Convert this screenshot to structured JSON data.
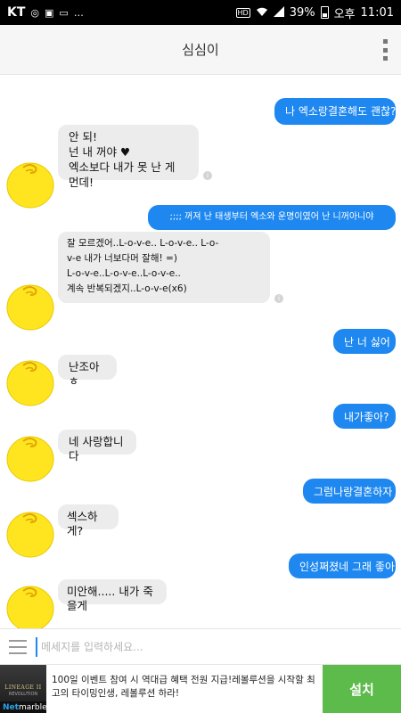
{
  "status_bar": {
    "carrier": "KT",
    "battery": "39%",
    "ampm": "오후",
    "time": "11:01",
    "hd_label": "HD"
  },
  "app": {
    "title": "심심이"
  },
  "messages": [
    {
      "from": "user",
      "text": "나 엑소랑결혼해도 괜찮?"
    },
    {
      "from": "bot",
      "text": "안 되!\n넌 내 꺼야 ♥\n엑소보다 내가 못 난 게 먼데!"
    },
    {
      "from": "user",
      "text": ";;;; 꺼져 난 태생부터 엑소와 운명이였어 난 니꺼아니야"
    },
    {
      "from": "bot",
      "text": "잘 모르겠어..L-o-v-e.. L-o-v-e.. L-o-\nv-e   내가 너보다머 잘해! =)\nL-o-v-e..L-o-v-e..L-o-v-e..\n계속 반복되겠지..L-o-v-e(x6)"
    },
    {
      "from": "user",
      "text": "난 너 싫어"
    },
    {
      "from": "bot",
      "text": "난조아 ㅎ"
    },
    {
      "from": "user",
      "text": "내가좋아?"
    },
    {
      "from": "bot",
      "text": "네 사랑합니다"
    },
    {
      "from": "user",
      "text": "그럼나랑결혼하자"
    },
    {
      "from": "bot",
      "text": "섹스하게?"
    },
    {
      "from": "user",
      "text": "인성쩌졌네 그래 좋아"
    },
    {
      "from": "bot",
      "text": "미안해..... 내가 죽을게"
    }
  ],
  "composer": {
    "placeholder": "메세지를 입력하세요..."
  },
  "ad": {
    "logo_line1": "LINEAGE II",
    "logo_line2": "REVOLUTION",
    "brand_prefix": "Net",
    "brand_suffix": "marble",
    "text": "100일 이벤트 참여 시 역대급 혜택 전원 지급!레볼루션을 시작할 최고의 타이밍인생, 레볼루션 하라!",
    "install_label": "설치"
  },
  "colors": {
    "user_bubble": "#1e88f0",
    "bot_bubble": "#ececec",
    "install_button": "#5dbb4b"
  }
}
